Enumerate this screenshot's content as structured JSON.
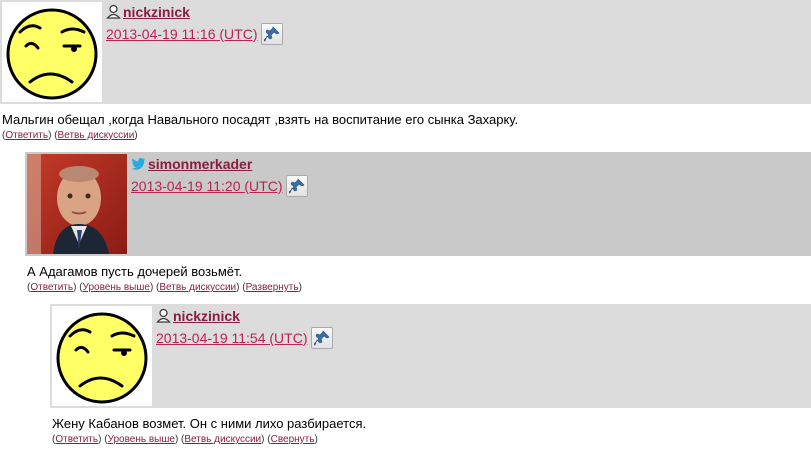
{
  "comments": [
    {
      "username": "nickzinick",
      "user_type_icon": "user-icon",
      "avatar": "yellow-smiley-avatar",
      "date": "2013-04-19 11:16 (UTC)",
      "pin_icon": "pushpin-icon",
      "text": "Мальгин обещал ,когда Навального посадят ,взять на воспитание его сынка Захарку.",
      "links": [
        "Ответить",
        "Ветвь дискуссии"
      ]
    },
    {
      "username": "simonmerkader",
      "user_type_icon": "twitter-bird-icon",
      "avatar": "photo-avatar",
      "date": "2013-04-19 11:20 (UTC)",
      "pin_icon": "pushpin-icon",
      "text": "А Адагамов пусть дочерей возьмёт.",
      "links": [
        "Ответить",
        "Уровень выше",
        "Ветвь дискуссии",
        "Развернуть"
      ]
    },
    {
      "username": "nickzinick",
      "user_type_icon": "user-icon",
      "avatar": "yellow-smiley-avatar",
      "date": "2013-04-19 11:54 (UTC)",
      "pin_icon": "pushpin-icon",
      "text": "Жену Кабанов возмет. Он с ними лихо разбирается.",
      "links": [
        "Ответить",
        "Уровень выше",
        "Ветвь дискуссии",
        "Свернуть"
      ]
    }
  ],
  "colors": {
    "link": "#8c1d40",
    "date": "#c0214f",
    "header_bg": "#dcdcdc",
    "header_bg_alt": "#c9c9c9",
    "smiley_yellow": "#ffff66"
  }
}
